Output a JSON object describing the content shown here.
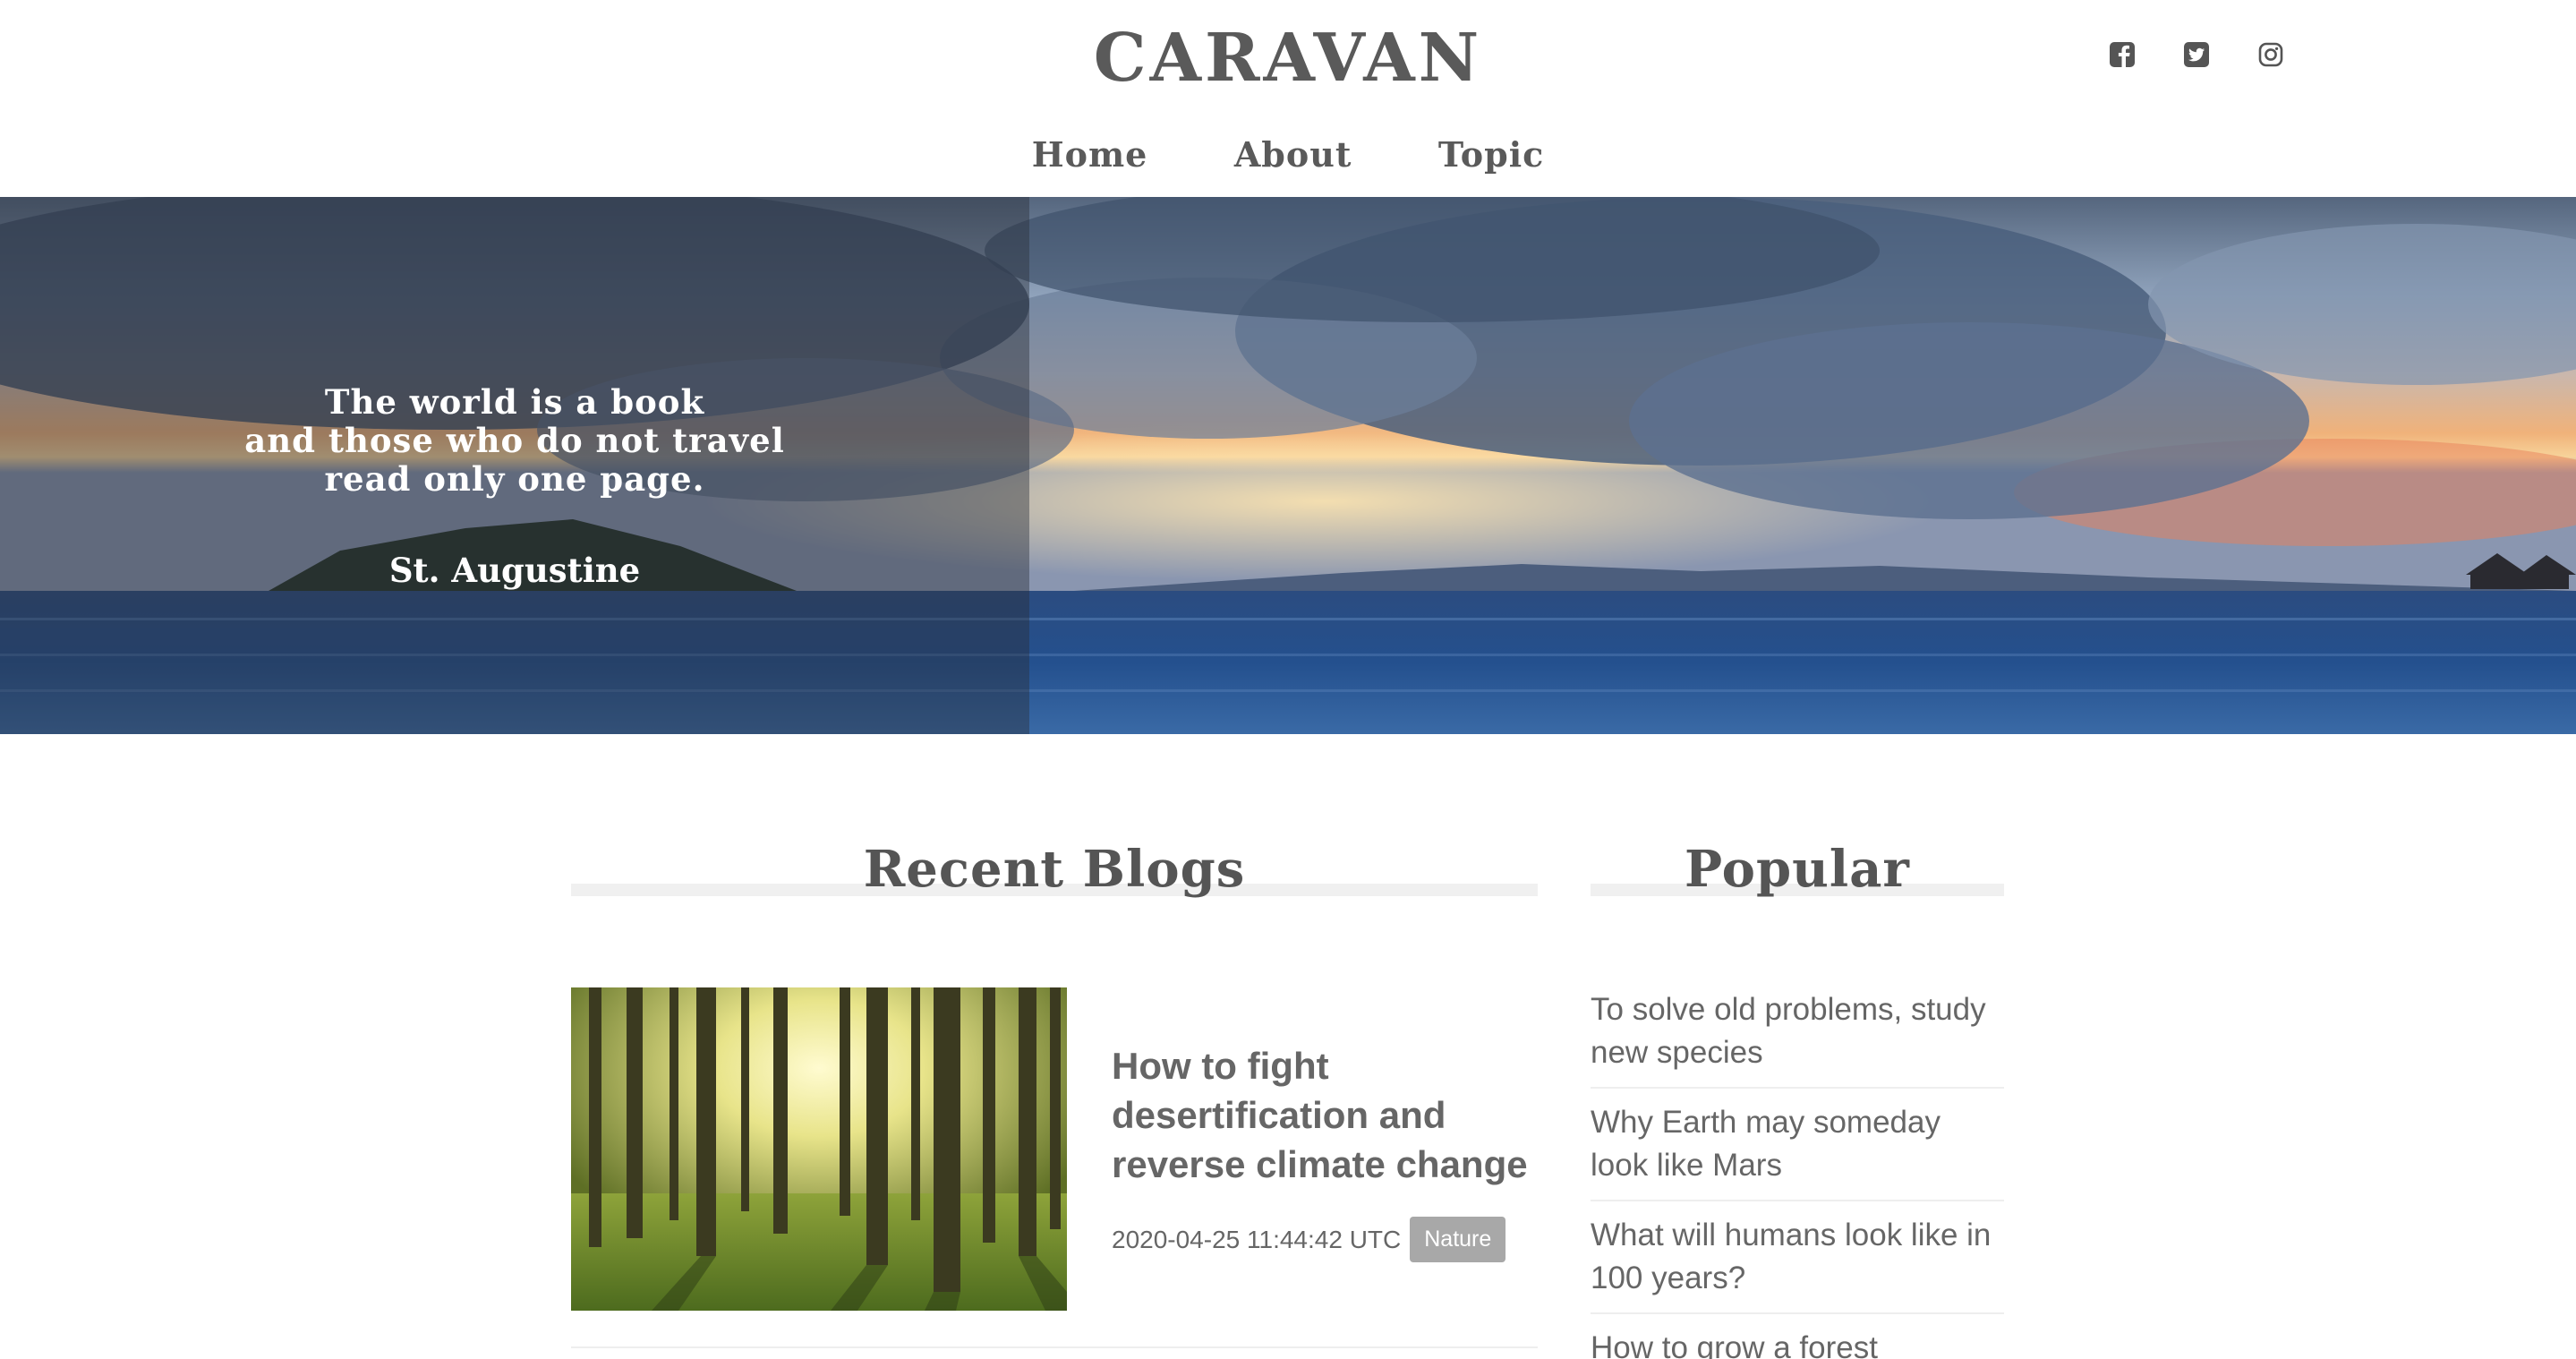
{
  "header": {
    "logo": "CARAVAN",
    "social": [
      {
        "name": "facebook-icon"
      },
      {
        "name": "twitter-icon"
      },
      {
        "name": "instagram-icon"
      }
    ],
    "nav": [
      {
        "label": "Home"
      },
      {
        "label": "About"
      },
      {
        "label": "Topic"
      }
    ]
  },
  "hero": {
    "quote_lines": [
      "The world is a book",
      "and those who do not travel",
      "read only one page."
    ],
    "author": "St. Augustine"
  },
  "recent": {
    "title": "Recent Blogs",
    "posts": [
      {
        "title": "How to fight desertification and reverse climate change",
        "date": "2020-04-25 11:44:42 UTC",
        "tag": "Nature"
      }
    ]
  },
  "popular": {
    "title": "Popular",
    "items": [
      {
        "title": "To solve old problems, study new species"
      },
      {
        "title": "Why Earth may someday look like Mars"
      },
      {
        "title": "What will humans look like in 100 years?"
      },
      {
        "title": "How to grow a forest"
      }
    ]
  },
  "colors": {
    "text": "#606060",
    "tag_bg": "#a8a8a8",
    "divider": "#eeeeee"
  }
}
